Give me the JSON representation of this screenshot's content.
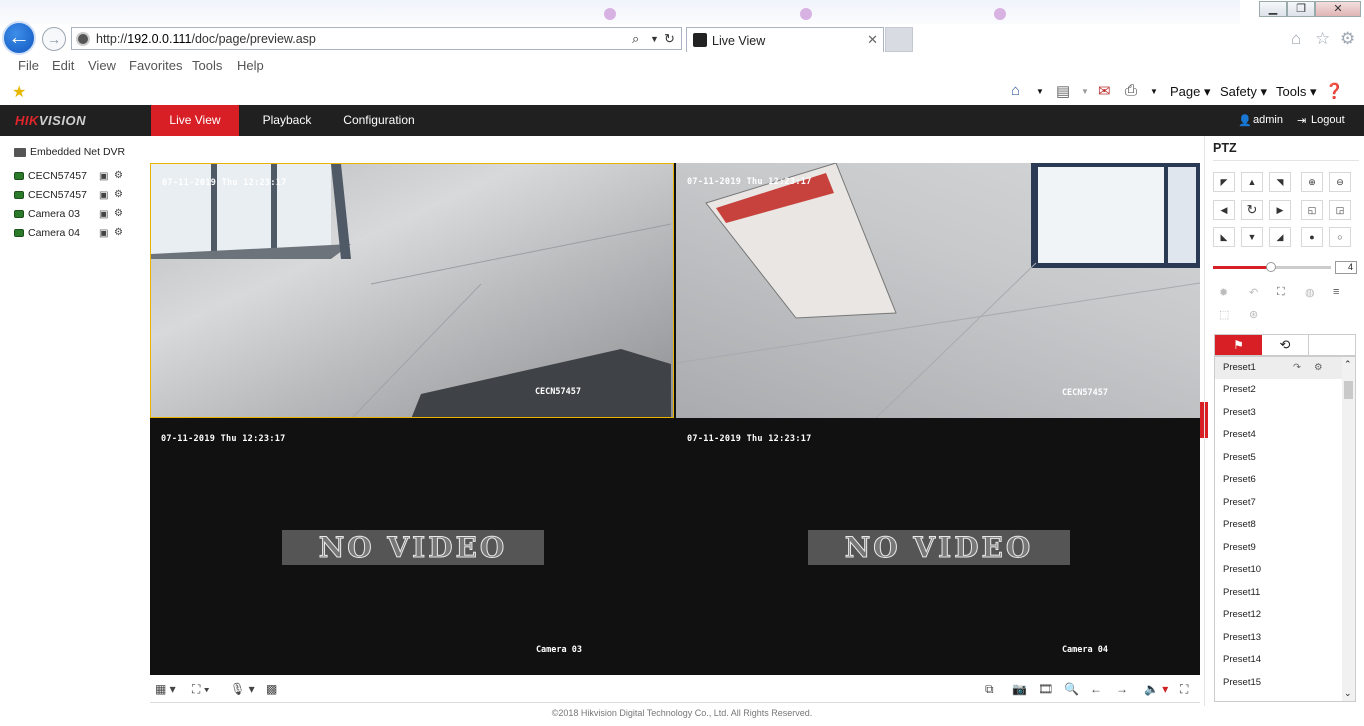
{
  "browser": {
    "url_prefix": "http://",
    "url_host": "192.0.0.111",
    "url_path": "/doc/page/preview.asp",
    "tab_title": "Live View",
    "menu": [
      "File",
      "Edit",
      "View",
      "Favorites",
      "Tools",
      "Help"
    ],
    "commands": {
      "page": "Page",
      "safety": "Safety",
      "tools": "Tools"
    }
  },
  "app": {
    "logo": "HIK",
    "logo_suffix": "VISION",
    "nav": [
      "Live View",
      "Playback",
      "Configuration"
    ],
    "user": "admin",
    "logout": "Logout"
  },
  "tree": {
    "root": "Embedded Net DVR",
    "cameras": [
      "CECN57457",
      "CECN57457",
      "Camera 03",
      "Camera 04"
    ]
  },
  "views": [
    {
      "timestamp": "07-11-2019 Thu 12:23:17",
      "name": "CECN57457",
      "no_video": ""
    },
    {
      "timestamp": "07-11-2019 Thu 12:23:17",
      "name": "CECN57457",
      "no_video": ""
    },
    {
      "timestamp": "07-11-2019 Thu 12:23:17",
      "name": "Camera 03",
      "no_video": "NO VIDEO"
    },
    {
      "timestamp": "07-11-2019 Thu 12:23:17",
      "name": "Camera 04",
      "no_video": "NO VIDEO"
    }
  ],
  "ptz": {
    "title": "PTZ",
    "speed": "4",
    "presets": [
      "Preset1",
      "Preset2",
      "Preset3",
      "Preset4",
      "Preset5",
      "Preset6",
      "Preset7",
      "Preset8",
      "Preset9",
      "Preset10",
      "Preset11",
      "Preset12",
      "Preset13",
      "Preset14",
      "Preset15"
    ]
  },
  "footer": "©2018 Hikvision Digital Technology Co., Ltd. All Rights Reserved.",
  "colors": {
    "brand_red": "#d81f26",
    "header_bg": "#202020"
  }
}
